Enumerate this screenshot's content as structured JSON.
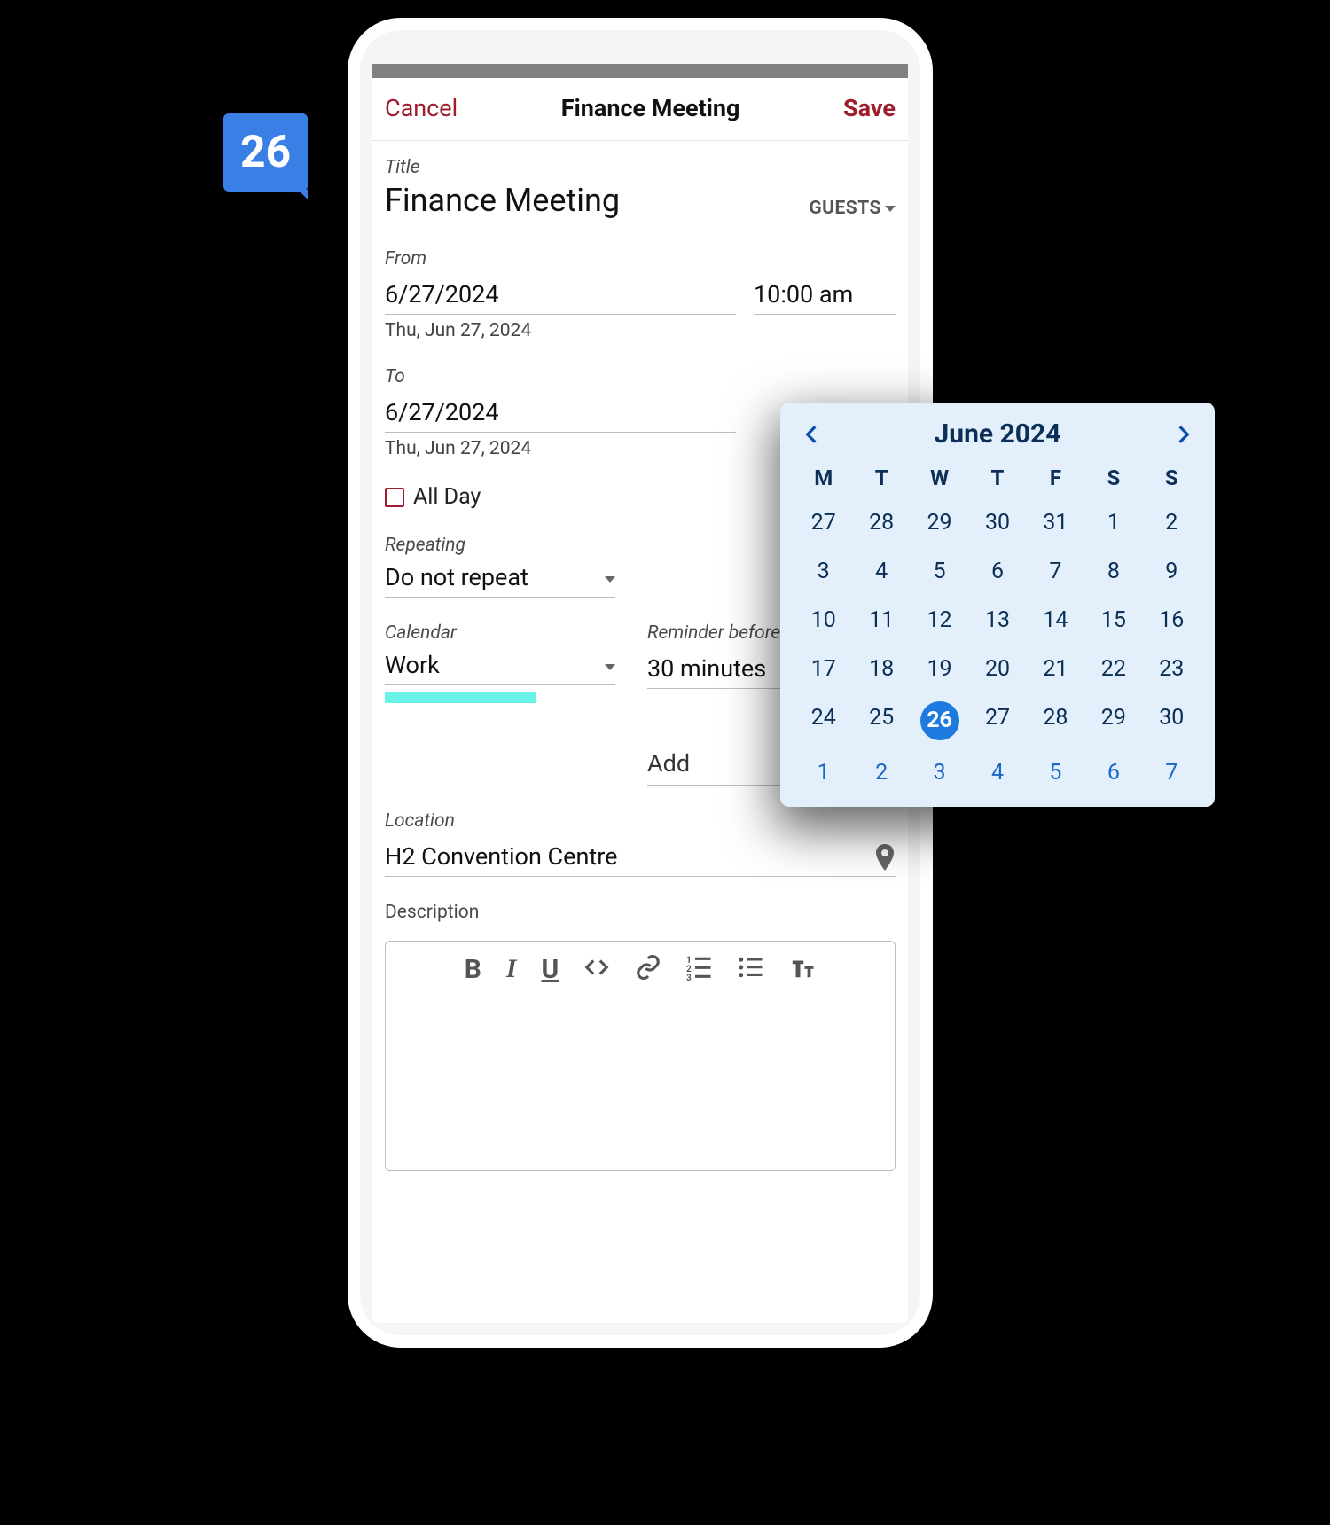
{
  "badge": {
    "day_number": "26"
  },
  "header": {
    "cancel": "Cancel",
    "title": "Finance Meeting",
    "save": "Save"
  },
  "event": {
    "title_label": "Title",
    "title_value": "Finance Meeting",
    "guests_label": "GUESTS",
    "from_label": "From",
    "from_date": "6/27/2024",
    "from_time": "10:00 am",
    "from_readable": "Thu, Jun 27, 2024",
    "to_label": "To",
    "to_date": "6/27/2024",
    "to_readable": "Thu, Jun 27, 2024",
    "all_day_label": "All Day",
    "all_day_checked": false,
    "repeating_label": "Repeating",
    "repeating_value": "Do not repeat",
    "calendar_label": "Calendar",
    "calendar_value": "Work",
    "calendar_color": "#69f3e8",
    "reminder_label": "Reminder before event",
    "reminder_value": "30 minutes",
    "add_label": "Add",
    "location_label": "Location",
    "location_value": "H2 Convention Centre",
    "description_label": "Description",
    "description_value": ""
  },
  "toolbar_icons": [
    "bold",
    "italic",
    "underline",
    "code",
    "link",
    "ordered-list",
    "unordered-list",
    "text-size"
  ],
  "datepicker": {
    "month_label": "June 2024",
    "dow": [
      "M",
      "T",
      "W",
      "T",
      "F",
      "S",
      "S"
    ],
    "rows": [
      [
        {
          "n": "27",
          "t": "prev"
        },
        {
          "n": "28",
          "t": "prev"
        },
        {
          "n": "29",
          "t": "prev"
        },
        {
          "n": "30",
          "t": "prev"
        },
        {
          "n": "31",
          "t": "prev"
        },
        {
          "n": "1",
          "t": "cur"
        },
        {
          "n": "2",
          "t": "cur"
        }
      ],
      [
        {
          "n": "3",
          "t": "cur"
        },
        {
          "n": "4",
          "t": "cur"
        },
        {
          "n": "5",
          "t": "cur"
        },
        {
          "n": "6",
          "t": "cur"
        },
        {
          "n": "7",
          "t": "cur"
        },
        {
          "n": "8",
          "t": "cur"
        },
        {
          "n": "9",
          "t": "cur"
        }
      ],
      [
        {
          "n": "10",
          "t": "cur"
        },
        {
          "n": "11",
          "t": "cur"
        },
        {
          "n": "12",
          "t": "cur"
        },
        {
          "n": "13",
          "t": "cur"
        },
        {
          "n": "14",
          "t": "cur"
        },
        {
          "n": "15",
          "t": "cur"
        },
        {
          "n": "16",
          "t": "cur"
        }
      ],
      [
        {
          "n": "17",
          "t": "cur"
        },
        {
          "n": "18",
          "t": "cur"
        },
        {
          "n": "19",
          "t": "cur"
        },
        {
          "n": "20",
          "t": "cur"
        },
        {
          "n": "21",
          "t": "cur"
        },
        {
          "n": "22",
          "t": "cur"
        },
        {
          "n": "23",
          "t": "cur"
        }
      ],
      [
        {
          "n": "24",
          "t": "cur"
        },
        {
          "n": "25",
          "t": "cur"
        },
        {
          "n": "26",
          "t": "sel"
        },
        {
          "n": "27",
          "t": "cur"
        },
        {
          "n": "28",
          "t": "cur"
        },
        {
          "n": "29",
          "t": "cur"
        },
        {
          "n": "30",
          "t": "cur"
        }
      ],
      [
        {
          "n": "1",
          "t": "next"
        },
        {
          "n": "2",
          "t": "next"
        },
        {
          "n": "3",
          "t": "next"
        },
        {
          "n": "4",
          "t": "next"
        },
        {
          "n": "5",
          "t": "next"
        },
        {
          "n": "6",
          "t": "next"
        },
        {
          "n": "7",
          "t": "next"
        }
      ]
    ]
  }
}
